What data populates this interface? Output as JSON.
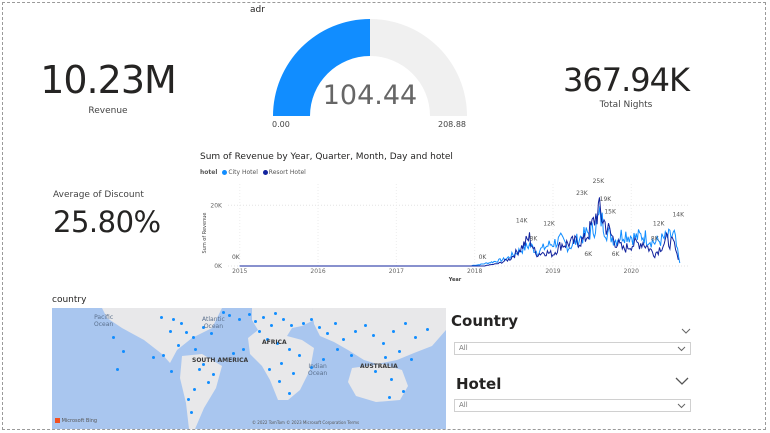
{
  "cards": {
    "revenue": {
      "value": "10.23M",
      "label": "Revenue"
    },
    "total_nights": {
      "value": "367.94K",
      "label": "Total Nights"
    },
    "discount": {
      "label": "Average of Discount",
      "value": "25.80%"
    }
  },
  "gauge": {
    "title": "adr",
    "value": 104.44,
    "value_text": "104.44",
    "min_text": "0.00",
    "max_text": "208.88",
    "fill_color": "#118DFF",
    "track_color": "#F0F0F0"
  },
  "line_chart": {
    "title": "Sum of Revenue by Year, Quarter, Month, Day and hotel",
    "legend_title": "hotel"
  },
  "chart_data": {
    "type": "line",
    "title": "Sum of Revenue by Year, Quarter, Month, Day and hotel",
    "xlabel": "Year",
    "ylabel": "Sum of Revenue",
    "x_ticks": [
      "2015",
      "2016",
      "2017",
      "2018",
      "2019",
      "2020"
    ],
    "y_ticks": [
      "0K",
      "20K"
    ],
    "ylim": [
      0,
      27
    ],
    "xlim": [
      2014.85,
      2020.75
    ],
    "legend_position": "top-left",
    "series": [
      {
        "name": "City Hotel",
        "color": "#118DFF",
        "points": [
          [
            2015.0,
            0
          ],
          [
            2017.9,
            0
          ],
          [
            2018.05,
            0.5
          ],
          [
            2018.2,
            1.5
          ],
          [
            2018.4,
            3
          ],
          [
            2018.55,
            6
          ],
          [
            2018.7,
            9
          ],
          [
            2018.8,
            6
          ],
          [
            2018.95,
            9
          ],
          [
            2019.1,
            11
          ],
          [
            2019.2,
            8
          ],
          [
            2019.35,
            12
          ],
          [
            2019.5,
            15
          ],
          [
            2019.6,
            21
          ],
          [
            2019.7,
            14
          ],
          [
            2019.8,
            11
          ],
          [
            2019.9,
            14
          ],
          [
            2020.05,
            12
          ],
          [
            2020.15,
            13
          ],
          [
            2020.3,
            10
          ],
          [
            2020.45,
            12
          ],
          [
            2020.55,
            13
          ],
          [
            2020.62,
            1
          ]
        ]
      },
      {
        "name": "Resort Hotel",
        "color": "#12239E",
        "points": [
          [
            2015.0,
            0
          ],
          [
            2018.1,
            0
          ],
          [
            2018.3,
            1
          ],
          [
            2018.45,
            3
          ],
          [
            2018.6,
            8
          ],
          [
            2018.7,
            12
          ],
          [
            2018.78,
            5
          ],
          [
            2018.9,
            6
          ],
          [
            2019.0,
            5
          ],
          [
            2019.1,
            9
          ],
          [
            2019.25,
            10
          ],
          [
            2019.4,
            11
          ],
          [
            2019.5,
            17
          ],
          [
            2019.58,
            24
          ],
          [
            2019.68,
            17
          ],
          [
            2019.78,
            11
          ],
          [
            2019.9,
            7
          ],
          [
            2020.0,
            9
          ],
          [
            2020.15,
            10
          ],
          [
            2020.3,
            5
          ],
          [
            2020.45,
            11
          ],
          [
            2020.55,
            9
          ],
          [
            2020.6,
            2
          ]
        ]
      }
    ],
    "data_labels": [
      {
        "text": "0K",
        "x": 2014.95,
        "y": 2
      },
      {
        "text": "0K",
        "x": 2018.1,
        "y": 2
      },
      {
        "text": "14K",
        "x": 2018.6,
        "y": 14
      },
      {
        "text": "8K",
        "x": 2018.75,
        "y": 8
      },
      {
        "text": "12K",
        "x": 2018.95,
        "y": 13
      },
      {
        "text": "23K",
        "x": 2019.37,
        "y": 23
      },
      {
        "text": "25K",
        "x": 2019.58,
        "y": 27
      },
      {
        "text": "19K",
        "x": 2019.67,
        "y": 21
      },
      {
        "text": "15K",
        "x": 2019.73,
        "y": 17
      },
      {
        "text": "12K",
        "x": 2020.35,
        "y": 13
      },
      {
        "text": "14K",
        "x": 2020.6,
        "y": 16
      },
      {
        "text": "8K",
        "x": 2020.3,
        "y": 8
      },
      {
        "text": "6K",
        "x": 2019.45,
        "y": 3
      },
      {
        "text": "6K",
        "x": 2019.8,
        "y": 3
      }
    ]
  },
  "map": {
    "title": "country",
    "labels": {
      "pacific": "Pacific\nOcean",
      "atlantic": "Atlantic\nOcean",
      "africa": "AFRICA",
      "south_america": "SOUTH AMERICA",
      "indian": "Indian\nOcean",
      "australia": "AUSTRALIA"
    },
    "logo": "Microsoft Bing",
    "copyright": "© 2022 TomTom  © 2023 Microsoft Corporation  Terms",
    "dot_color": "#118DFF",
    "land_color": "#e8e8ea",
    "water_color": "#a9c6ef"
  },
  "slicers": {
    "country": {
      "title": "Country",
      "value": "All"
    },
    "hotel": {
      "title": "Hotel",
      "value": "All"
    }
  }
}
